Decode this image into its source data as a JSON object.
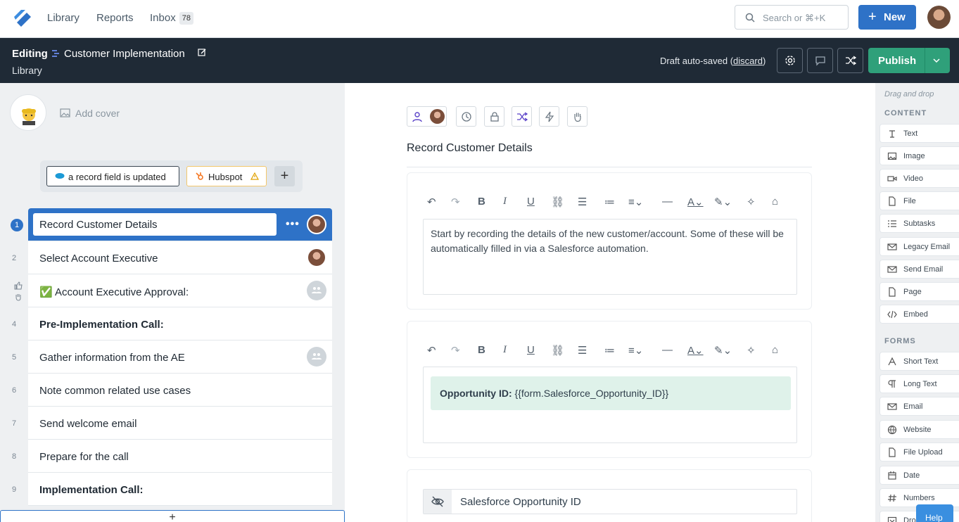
{
  "nav": {
    "links": [
      "Library",
      "Reports",
      "Inbox"
    ],
    "inbox_count": "78",
    "search_placeholder": "Search or ⌘+K",
    "new_label": "New"
  },
  "header": {
    "editing": "Editing",
    "title": "Customer Implementation",
    "breadcrumb": "Library",
    "draft_prefix": "Draft auto-saved (",
    "discard": "discard",
    "draft_suffix": ")",
    "publish": "Publish"
  },
  "left": {
    "add_cover": "Add cover",
    "trigger": "a record field is updated",
    "integration": "Hubspot",
    "steps": [
      {
        "num": "1",
        "label": "Record Customer Details",
        "bold": false
      },
      {
        "num": "2",
        "label": "Select Account Executive",
        "bold": false
      },
      {
        "num": "",
        "label": "✅ Account Executive Approval:",
        "bold": false
      },
      {
        "num": "4",
        "label": "Pre-Implementation Call:",
        "bold": true
      },
      {
        "num": "5",
        "label": "Gather information from the AE",
        "bold": false
      },
      {
        "num": "6",
        "label": "Note common related use cases",
        "bold": false
      },
      {
        "num": "7",
        "label": "Send welcome email",
        "bold": false
      },
      {
        "num": "8",
        "label": "Prepare for the call",
        "bold": false
      },
      {
        "num": "9",
        "label": "Implementation Call:",
        "bold": true
      }
    ],
    "add": "+"
  },
  "center": {
    "step_title": "Record Customer Details",
    "text_block": "Start by recording the details of the new customer/account. Some of these will be automatically filled in via a Salesforce automation.",
    "callout_label": "Opportunity ID:",
    "callout_value": "{{form.Salesforce_Opportunity_ID}}",
    "hidden_field": "Salesforce Opportunity ID"
  },
  "right": {
    "drag": "Drag and drop",
    "content_title": "CONTENT",
    "content_items": [
      "Text",
      "Image",
      "Video",
      "File",
      "Subtasks",
      "Legacy Email",
      "Send Email",
      "Page",
      "Embed"
    ],
    "forms_title": "FORMS",
    "form_items": [
      "Short Text",
      "Long Text",
      "Email",
      "Website",
      "File Upload",
      "Date",
      "Numbers",
      "Dro"
    ]
  },
  "help": "Help",
  "colors": {
    "accent": "#2e72c7",
    "dark": "#1f2a36",
    "publish": "#2fa07a"
  }
}
